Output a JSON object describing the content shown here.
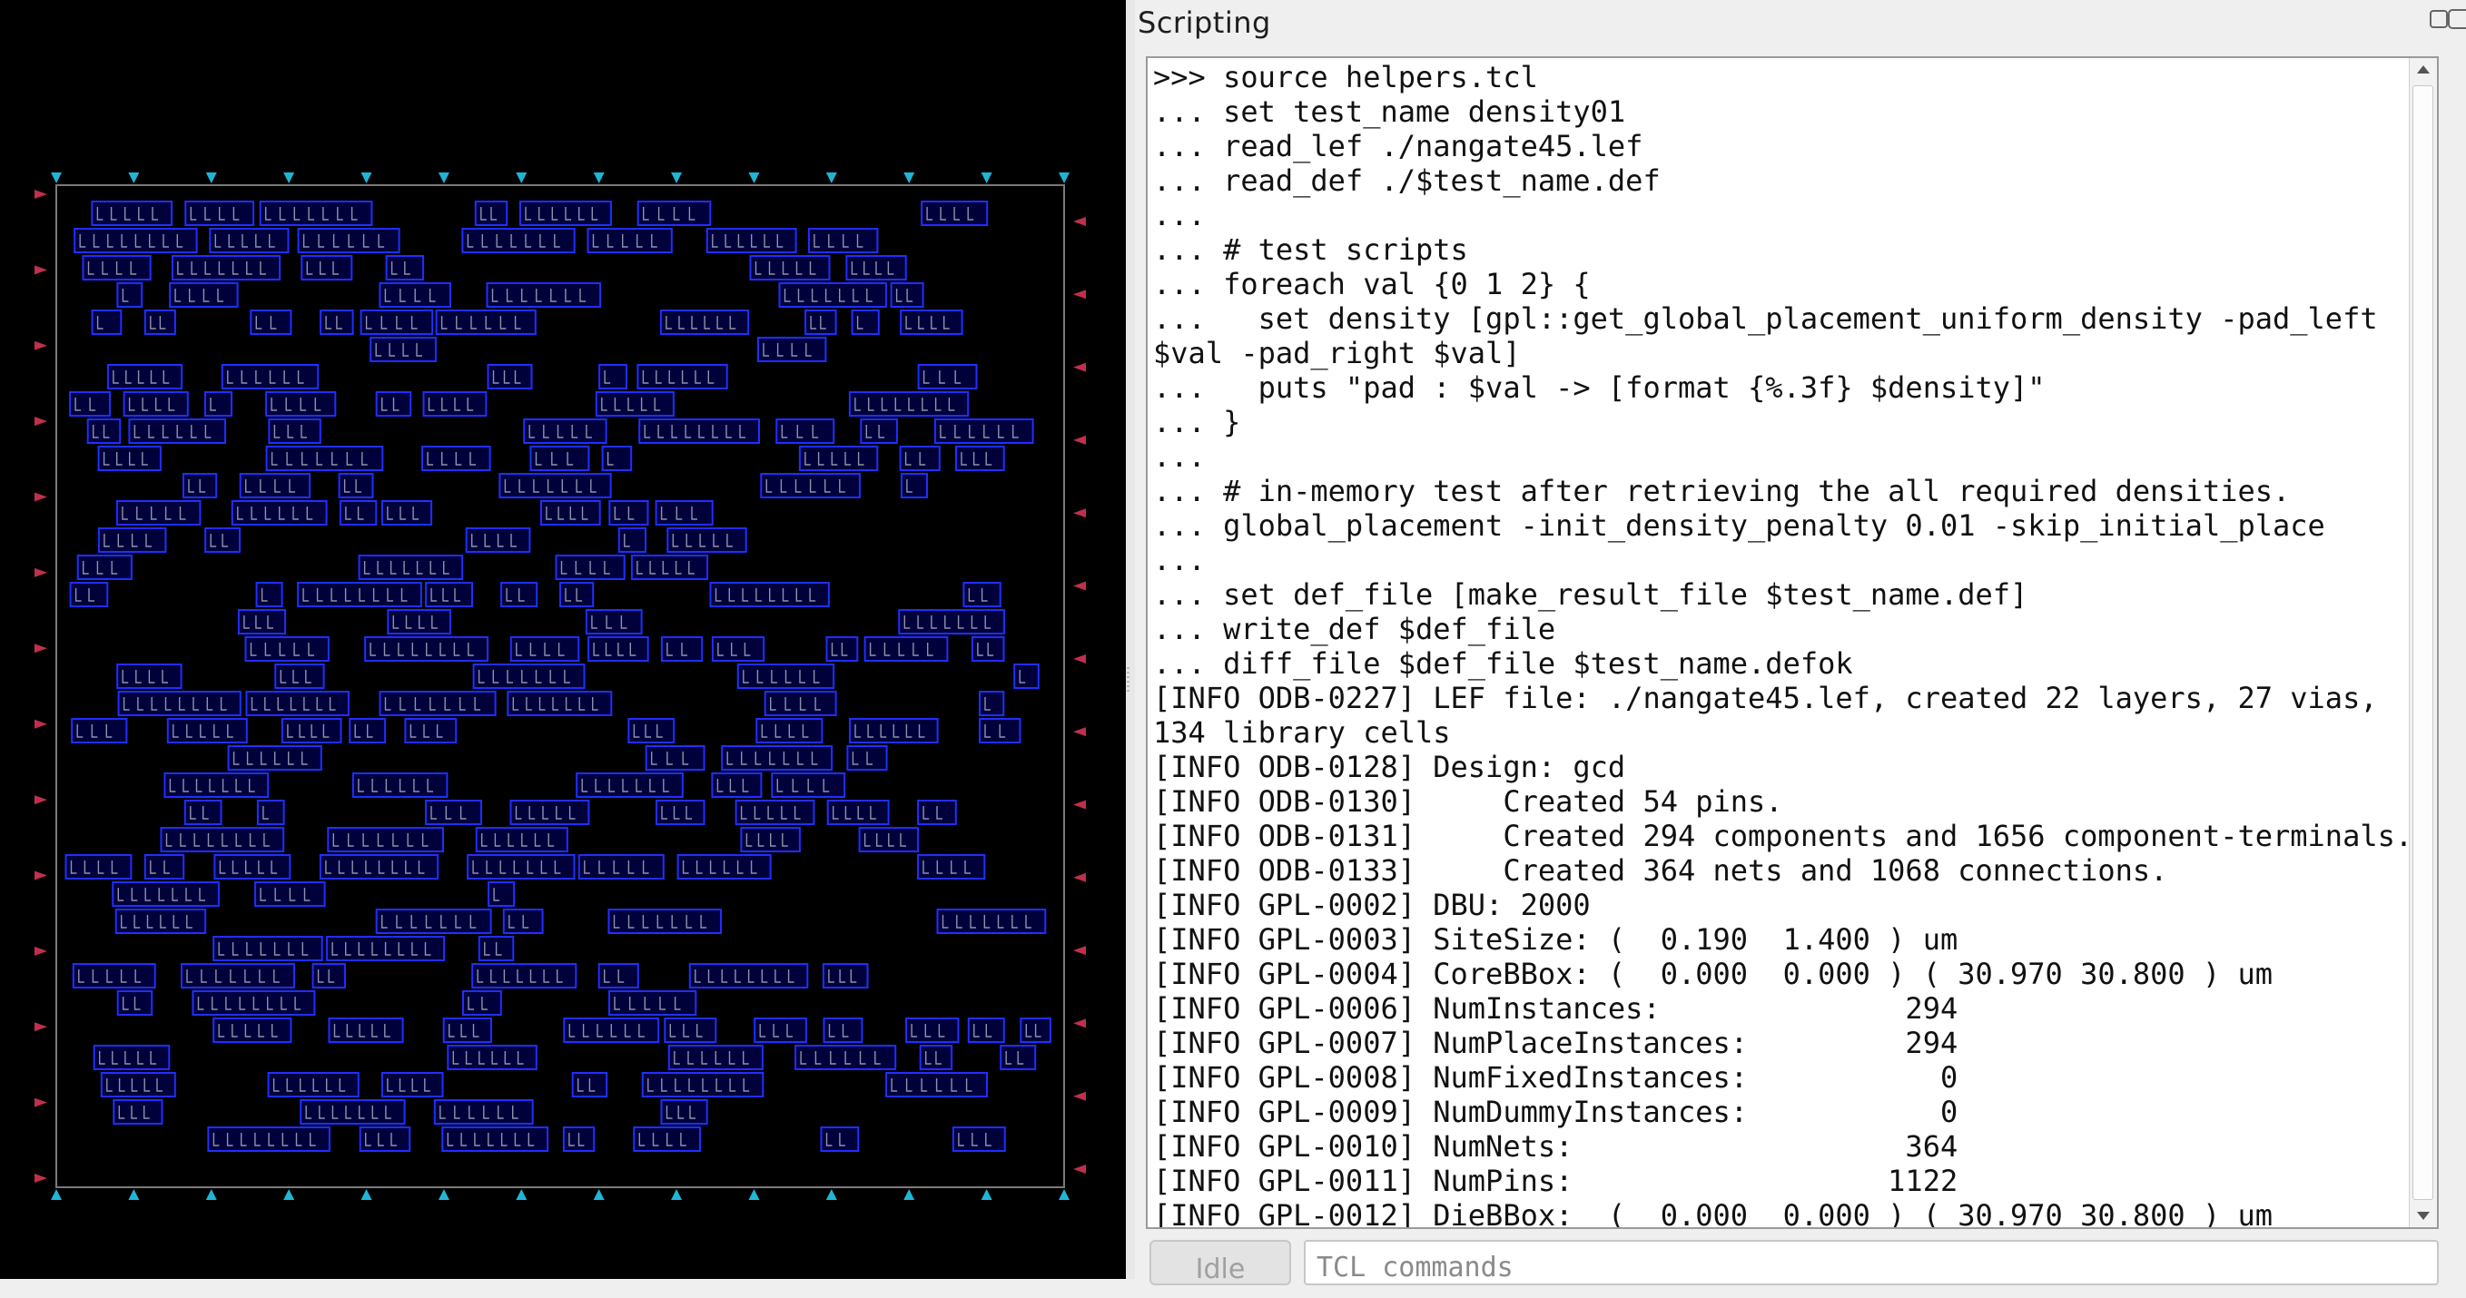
{
  "colors": {
    "canvas_bg": "#000000",
    "die_outline": "#7a7a7a",
    "instance_outline": "#1f2fff",
    "instance_fill": "#0000a8",
    "cell_internal_wires": "#b0b8c8",
    "io_pin_cyan": "#1fb6d6",
    "io_pin_red": "#c0304a"
  },
  "scripting_panel": {
    "title": "Scripting",
    "console_lines": [
      ">>> source helpers.tcl",
      "... set test_name density01",
      "... read_lef ./nangate45.lef",
      "... read_def ./$test_name.def",
      "...",
      "... # test scripts",
      "... foreach val {0 1 2} {",
      "...   set density [gpl::get_global_placement_uniform_density -pad_left",
      "$val -pad_right $val]",
      "...   puts \"pad : $val -> [format {%.3f} $density]\"",
      "... }",
      "...",
      "... # in-memory test after retrieving the all required densities.",
      "... global_placement -init_density_penalty 0.01 -skip_initial_place",
      "...",
      "... set def_file [make_result_file $test_name.def]",
      "... write_def $def_file",
      "... diff_file $def_file $test_name.defok",
      "[INFO ODB-0227] LEF file: ./nangate45.lef, created 22 layers, 27 vias,",
      "134 library cells",
      "[INFO ODB-0128] Design: gcd",
      "[INFO ODB-0130]     Created 54 pins.",
      "[INFO ODB-0131]     Created 294 components and 1656 component-terminals.",
      "[INFO ODB-0133]     Created 364 nets and 1068 connections.",
      "[INFO GPL-0002] DBU: 2000",
      "[INFO GPL-0003] SiteSize: (  0.190  1.400 ) um",
      "[INFO GPL-0004] CoreBBox: (  0.000  0.000 ) ( 30.970 30.800 ) um",
      "[INFO GPL-0006] NumInstances:              294",
      "[INFO GPL-0007] NumPlaceInstances:         294",
      "[INFO GPL-0008] NumFixedInstances:           0",
      "[INFO GPL-0009] NumDummyInstances:           0",
      "[INFO GPL-0010] NumNets:                   364",
      "[INFO GPL-0011] NumPins:                  1122",
      "[INFO GPL-0012] DieBBox:  (  0.000  0.000 ) ( 30.970 30.800 ) um"
    ],
    "status_label": "Idle",
    "command_placeholder": "TCL commands"
  }
}
